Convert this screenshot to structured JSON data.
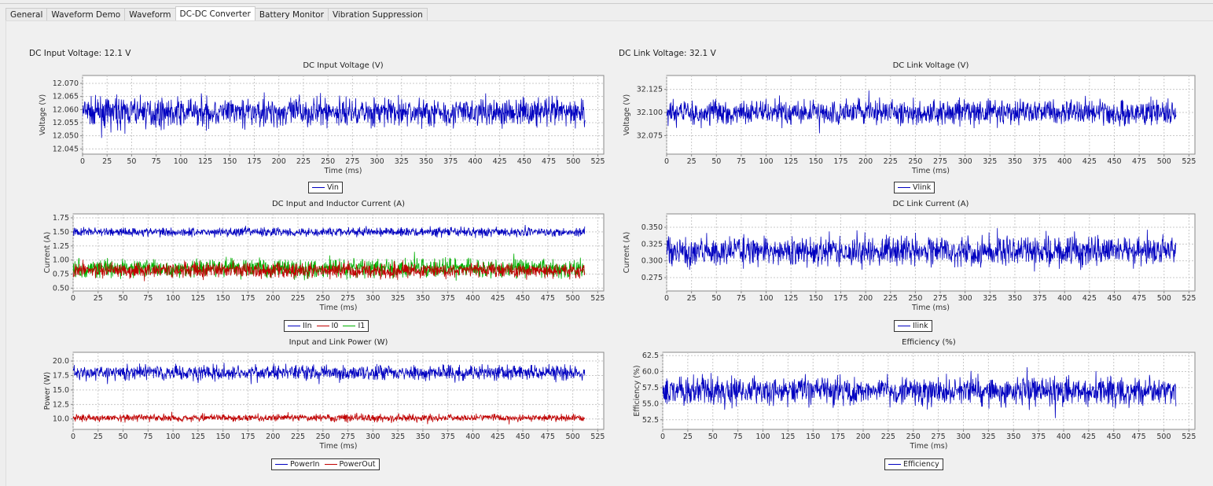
{
  "tabs": [
    "General",
    "Waveform Demo",
    "Waveform",
    "DC-DC Converter",
    "Battery Monitor",
    "Vibration Suppression"
  ],
  "active_tab": "DC-DC Converter",
  "readouts": {
    "input": "DC Input Voltage: 12.1 V",
    "link": "DC Link Voltage: 32.1 V"
  },
  "chart_data": [
    {
      "type": "line",
      "title": "DC Input Voltage (V)",
      "xlabel": "Time (ms)",
      "ylabel": "Voltage (V)",
      "xlim": [
        0,
        531
      ],
      "ylim": [
        12.043,
        12.073
      ],
      "xticks": [
        0,
        25,
        50,
        75,
        100,
        125,
        150,
        175,
        200,
        225,
        250,
        275,
        300,
        325,
        350,
        375,
        400,
        425,
        450,
        475,
        500,
        525
      ],
      "yticks": [
        12.045,
        12.05,
        12.055,
        12.06,
        12.065,
        12.07
      ],
      "ydec": 3,
      "x_range": [
        0,
        512
      ],
      "series": [
        {
          "name": "Vin",
          "color": "#0000c0",
          "mean": 12.059,
          "noise": 0.008
        }
      ]
    },
    {
      "type": "line",
      "title": "DC Input and Inductor Current (A)",
      "xlabel": "Time (ms)",
      "ylabel": "Current (A)",
      "xlim": [
        0,
        531
      ],
      "ylim": [
        0.45,
        1.82
      ],
      "xticks": [
        0,
        25,
        50,
        75,
        100,
        125,
        150,
        175,
        200,
        225,
        250,
        275,
        300,
        325,
        350,
        375,
        400,
        425,
        450,
        475,
        500,
        525
      ],
      "yticks": [
        0.5,
        0.75,
        1.0,
        1.25,
        1.5,
        1.75
      ],
      "ydec": 2,
      "x_range": [
        0,
        512
      ],
      "series": [
        {
          "name": "IIn",
          "color": "#0000c0",
          "mean": 1.5,
          "noise": 0.12
        },
        {
          "name": "I0",
          "color": "#c00000",
          "mean": 0.82,
          "noise": 0.2,
          "draw_last": true
        },
        {
          "name": "I1",
          "color": "#00b000",
          "mean": 0.85,
          "noise": 0.24
        }
      ]
    },
    {
      "type": "line",
      "title": "Input and Link Power (W)",
      "xlabel": "Time (ms)",
      "ylabel": "Power (W)",
      "xlim": [
        0,
        531
      ],
      "ylim": [
        8.2,
        21.5
      ],
      "xticks": [
        0,
        25,
        50,
        75,
        100,
        125,
        150,
        175,
        200,
        225,
        250,
        275,
        300,
        325,
        350,
        375,
        400,
        425,
        450,
        475,
        500,
        525
      ],
      "yticks": [
        10,
        12.5,
        15,
        17.5,
        20
      ],
      "ydec": 1,
      "x_range": [
        0,
        512
      ],
      "series": [
        {
          "name": "PowerIn",
          "color": "#0000c0",
          "mean": 18,
          "noise": 1.9
        },
        {
          "name": "PowerOut",
          "color": "#c00000",
          "mean": 10.2,
          "noise": 0.9
        }
      ]
    },
    {
      "type": "line",
      "title": "DC Link Voltage (V)",
      "xlabel": "Time (ms)",
      "ylabel": "Voltage (V)",
      "xlim": [
        0,
        531
      ],
      "ylim": [
        32.055,
        32.14
      ],
      "xticks": [
        0,
        25,
        50,
        75,
        100,
        125,
        150,
        175,
        200,
        225,
        250,
        275,
        300,
        325,
        350,
        375,
        400,
        425,
        450,
        475,
        500,
        525
      ],
      "yticks": [
        32.075,
        32.1,
        32.125
      ],
      "ydec": 3,
      "x_range": [
        0,
        512
      ],
      "series": [
        {
          "name": "Vlink",
          "color": "#0000c0",
          "mean": 32.1,
          "noise": 0.02
        }
      ]
    },
    {
      "type": "line",
      "title": "DC Link Current (A)",
      "xlabel": "Time (ms)",
      "ylabel": "Current (A)",
      "xlim": [
        0,
        531
      ],
      "ylim": [
        0.255,
        0.37
      ],
      "xticks": [
        0,
        25,
        50,
        75,
        100,
        125,
        150,
        175,
        200,
        225,
        250,
        275,
        300,
        325,
        350,
        375,
        400,
        425,
        450,
        475,
        500,
        525
      ],
      "yticks": [
        0.275,
        0.3,
        0.325,
        0.35
      ],
      "ydec": 3,
      "x_range": [
        0,
        512
      ],
      "series": [
        {
          "name": "Ilink",
          "color": "#0000c0",
          "mean": 0.315,
          "noise": 0.033
        }
      ]
    },
    {
      "type": "line",
      "title": "Efficiency (%)",
      "xlabel": "Time (ms)",
      "ylabel": "Efficiency (%)",
      "xlim": [
        0,
        531
      ],
      "ylim": [
        51,
        63
      ],
      "xticks": [
        0,
        25,
        50,
        75,
        100,
        125,
        150,
        175,
        200,
        225,
        250,
        275,
        300,
        325,
        350,
        375,
        400,
        425,
        450,
        475,
        500,
        525
      ],
      "yticks": [
        52.5,
        55,
        57.5,
        60,
        62.5
      ],
      "ydec": 1,
      "x_range": [
        0,
        512
      ],
      "series": [
        {
          "name": "Efficiency",
          "color": "#0000c0",
          "mean": 57,
          "noise": 3.2
        }
      ]
    }
  ]
}
